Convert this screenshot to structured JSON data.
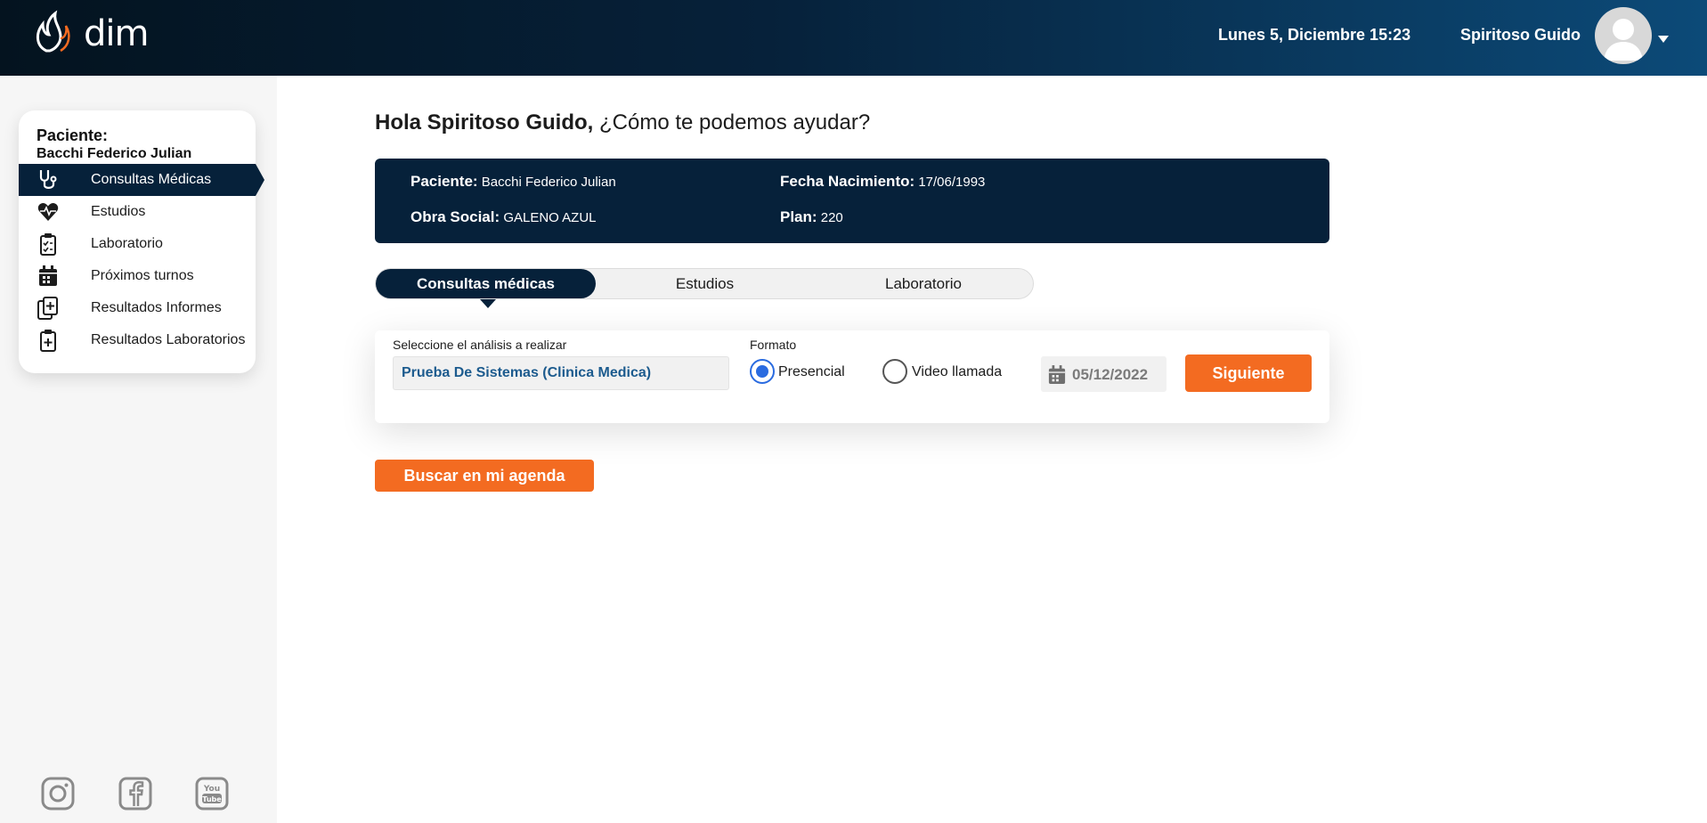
{
  "brand": {
    "name": "dim"
  },
  "header": {
    "datetime": "Lunes 5, Diciembre 15:23",
    "user_name": "Spiritoso Guido"
  },
  "sidebar": {
    "patient_title": "Paciente:",
    "patient_name": "Bacchi Federico Julian",
    "items": [
      {
        "label": "Consultas Médicas",
        "icon": "stethoscope-icon",
        "active": true
      },
      {
        "label": "Estudios",
        "icon": "heart-pulse-icon"
      },
      {
        "label": "Laboratorio",
        "icon": "clipboard-check-icon"
      },
      {
        "label": "Próximos turnos",
        "icon": "calendar-icon"
      },
      {
        "label": "Resultados Informes",
        "icon": "document-plus-icon"
      },
      {
        "label": "Resultados Laboratorios",
        "icon": "clipboard-plus-icon"
      }
    ],
    "social": [
      "instagram-icon",
      "facebook-icon",
      "youtube-icon"
    ]
  },
  "main": {
    "greeting_bold": "Hola Spiritoso Guido,",
    "greeting_rest": " ¿Cómo te podemos ayudar?",
    "info": {
      "patient_label": "Paciente:",
      "patient_value": "Bacchi Federico Julian",
      "birth_label": "Fecha Nacimiento:",
      "birth_value": "17/06/1993",
      "insurance_label": "Obra Social:",
      "insurance_value": "GALENO AZUL",
      "plan_label": "Plan:",
      "plan_value": "220"
    },
    "tabs": [
      {
        "label": "Consultas médicas",
        "active": true
      },
      {
        "label": "Estudios"
      },
      {
        "label": "Laboratorio"
      }
    ],
    "form": {
      "analysis_label": "Seleccione el análisis a realizar",
      "analysis_value": "Prueba De Sistemas (Clinica Medica)",
      "format_label": "Formato",
      "option_presencial": "Presencial",
      "option_video": "Video llamada",
      "selected_format": "Presencial",
      "date_value": "05/12/2022",
      "next_button": "Siguiente"
    },
    "agenda_button": "Buscar en mi agenda"
  },
  "colors": {
    "navy": "#06213a",
    "accent_orange": "#f36b21",
    "radio_blue": "#2a6be0",
    "select_text": "#1c5b8e"
  }
}
